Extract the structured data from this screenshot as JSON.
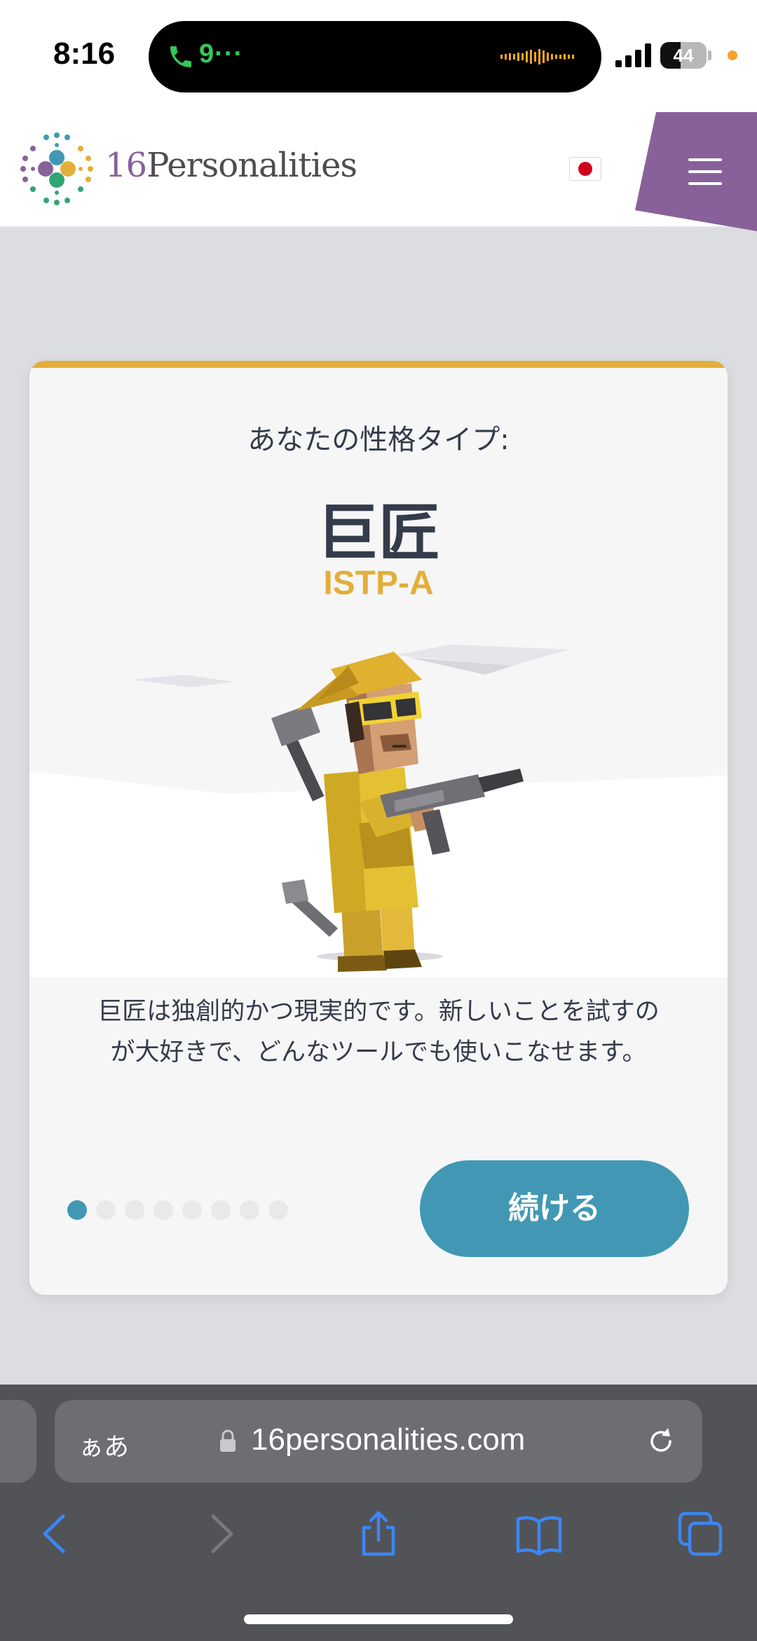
{
  "status_bar": {
    "time": "8:16",
    "call_text": "9···",
    "battery_level": 44,
    "battery_text": "44"
  },
  "header": {
    "logo_number": "16",
    "logo_word": "Personalities",
    "language_flag": "japan-flag",
    "menu_color": "#88619a"
  },
  "card": {
    "subtitle": "あなたの性格タイプ:",
    "title": "巨匠",
    "code": "ISTP-A",
    "description_line1": "巨匠は独創的かつ現実的です。新しいことを試すの",
    "description_line2": "が大好きで、どんなツールでも使いこなせます。",
    "dots_total": 8,
    "dots_active_index": 0,
    "continue_label": "続ける",
    "accent_color": "#e4ae3a",
    "button_color": "#4298b4"
  },
  "browser": {
    "aa_label": "ぁあ",
    "url": "16personalities.com",
    "toolbar_icons": [
      "back-icon",
      "forward-icon",
      "share-icon",
      "bookmarks-icon",
      "tabs-icon"
    ]
  }
}
